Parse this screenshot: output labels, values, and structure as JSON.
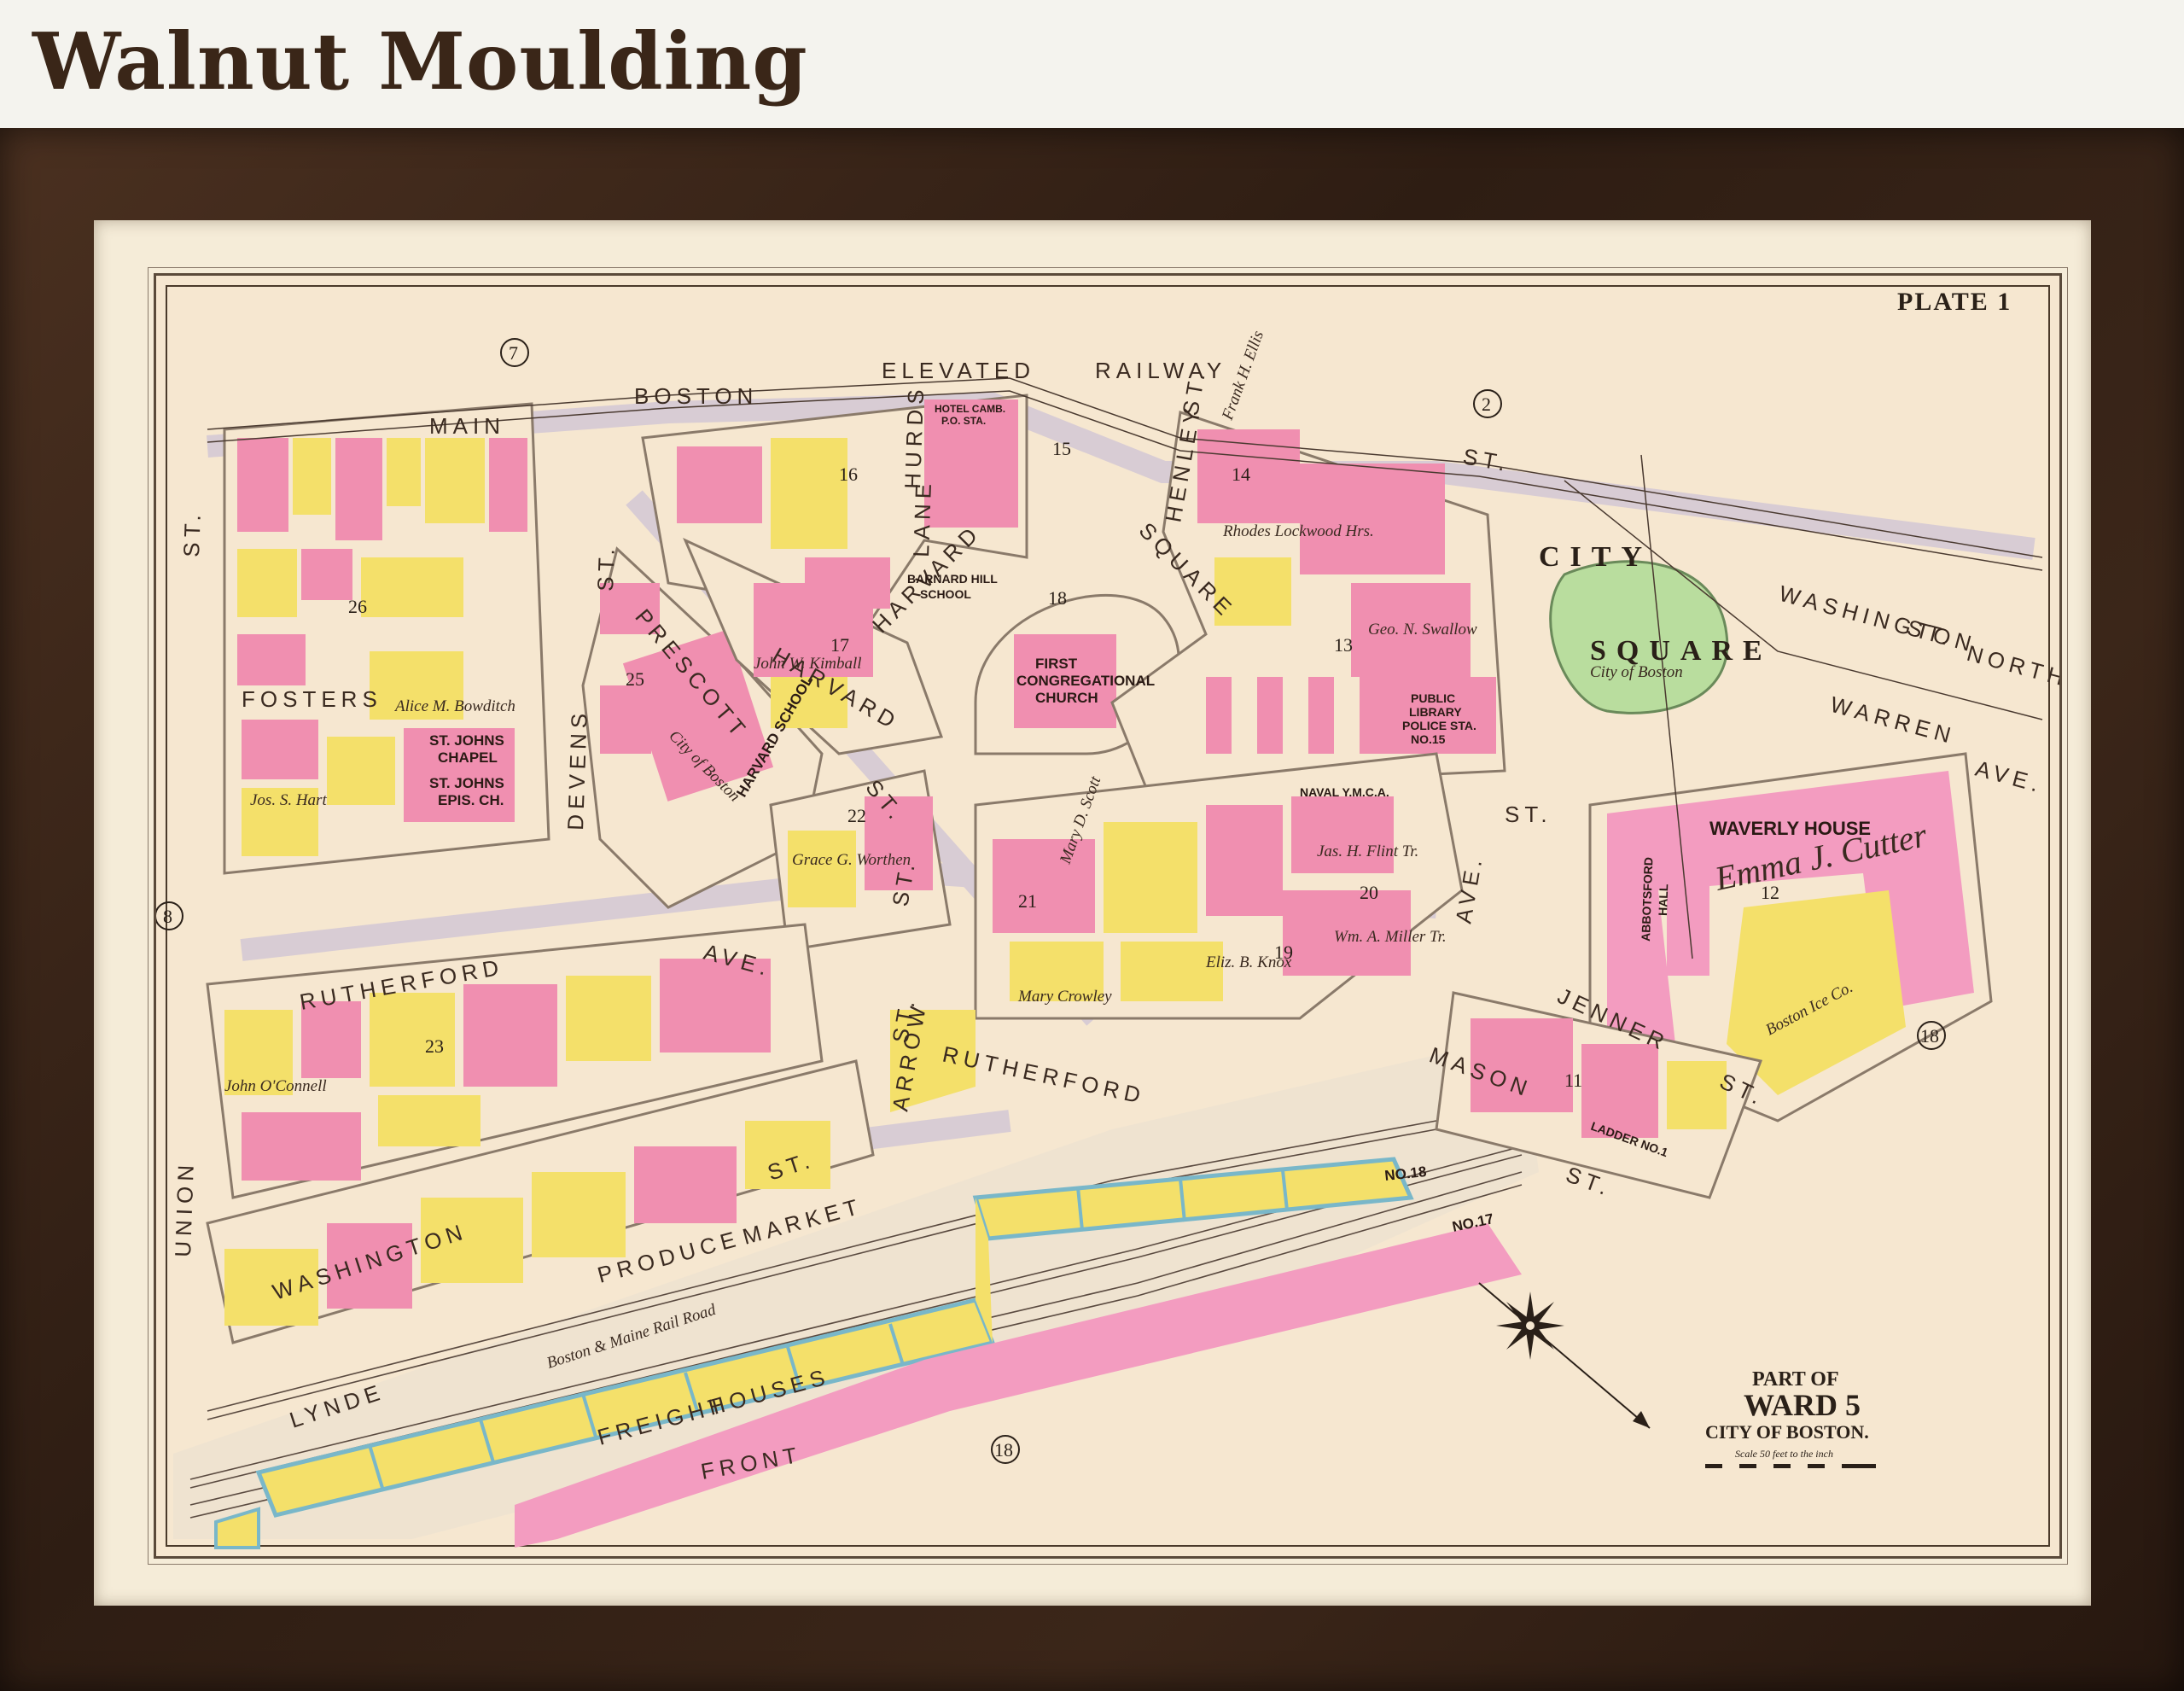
{
  "caption": "Walnut Moulding",
  "plate": "PLATE 1",
  "title_block": {
    "line1": "PART OF",
    "line2": "WARD 5",
    "line3": "CITY OF BOSTON.",
    "scale": "Scale 50 feet to the inch"
  },
  "streets": {
    "main": "MAIN",
    "main_st": "ST.",
    "boston": "BOSTON",
    "elevated": "ELEVATED",
    "railway": "RAILWAY",
    "harvard": "HARVARD",
    "harvard_square": "HARVARD",
    "square": "SQUARE",
    "prescott": "PRESCOTT",
    "prescott_st": "ST.",
    "harvard_st": "ST.",
    "devens": "DEVENS",
    "devens_st": "ST.",
    "rutherford": "RUTHERFORD",
    "rutherford_ave": "AVE.",
    "rutherford2": "RUTHERFORD",
    "washington": "WASHINGTON",
    "washington_st": "ST.",
    "washington_ne": "WASHINGTON",
    "washington_ne_st": "ST.",
    "north": "NORTH",
    "warren": "WARREN",
    "warren_ave": "AVE.",
    "union": "UNION",
    "union_st": "ST.",
    "lynde": "LYNDE",
    "front": "FRONT",
    "jenner": "JENNER",
    "jenner_st": "ST.",
    "mason": "MASON",
    "mason_st": "ST.",
    "henley": "HENLEY",
    "henley_st": "ST.",
    "hurds": "HURDS",
    "lane": "LANE",
    "arrow": "ARROW",
    "arrow_st": "ST.",
    "city_square_1": "CITY",
    "city_square_2": "SQUARE",
    "st_e": "ST.",
    "ave_e": "AVE.",
    "fosters": "FOSTERS",
    "produce": "PRODUCE",
    "market": "MARKET",
    "freight": "FREIGHT",
    "houses": "HOUSES",
    "rail_road": "Boston & Maine Rail Road",
    "no18": "NO.18",
    "no17": "NO.17"
  },
  "ward_numbers": [
    "7",
    "2",
    "8",
    "18",
    "18"
  ],
  "block_numbers": [
    "16",
    "15",
    "14",
    "18",
    "17",
    "25",
    "26",
    "13",
    "22",
    "23",
    "21",
    "19",
    "20",
    "12",
    "11"
  ],
  "buildings": {
    "first_church": [
      "FIRST",
      "CONGREGATIONAL",
      "CHURCH"
    ],
    "harvard_hill_school": [
      "BARNARD HILL",
      "SCHOOL"
    ],
    "harvard_school": "HARVARD SCHOOL",
    "st_johns_chapel": [
      "ST. JOHNS",
      "CHAPEL"
    ],
    "st_johns_epis": [
      "ST. JOHNS",
      "EPIS. CH."
    ],
    "public_library": [
      "PUBLIC",
      "LIBRARY",
      "POLICE STA.",
      "NO.15"
    ],
    "waverly_house": "WAVERLY HOUSE",
    "abbotsford_hall": [
      "ABBOTSFORD",
      "HALL"
    ],
    "ladder": "LADDER NO.1",
    "navy_ymca": "NAVAL Y.M.C.A.",
    "hotel": [
      "HOTEL CAMB.",
      "P.O. STA."
    ]
  },
  "owners": {
    "emma_cutter": "Emma J. Cutter",
    "boston_ice": "Boston Ice Co.",
    "city_of_boston_sq": "City of Boston",
    "city_of_boston_school": "City of Boston",
    "mary_scott": "Mary D. Scott",
    "alice_bowditch": "Alice M. Bowditch",
    "john_oconnell": "John O'Connell",
    "geo_swallow": "Geo. N. Swallow",
    "rhodes_lockwood": "Rhodes Lockwood Hrs.",
    "jas_flint": "Jas. H. Flint Tr.",
    "eliz_knox": "Eliz. B. Knox",
    "frank_ellis": "Frank H. Ellis",
    "jos_hart": "Jos. S. Hart",
    "wm_miller": "Wm. A. Miller Tr.",
    "grace_worthen": "Grace G. Worthen",
    "john_kimball": "John W. Kimball",
    "mary_crowley": "Mary Crowley"
  },
  "colors": {
    "frame": "#3b2619",
    "mat": "#f5ecd8",
    "paper": "#f6e7d0",
    "brick_pink": "#f08fb0",
    "wood_yellow": "#f4e06a",
    "park_green": "#b9dd9e",
    "street_gray": "#c9bfc8",
    "ink": "#2a2018"
  }
}
